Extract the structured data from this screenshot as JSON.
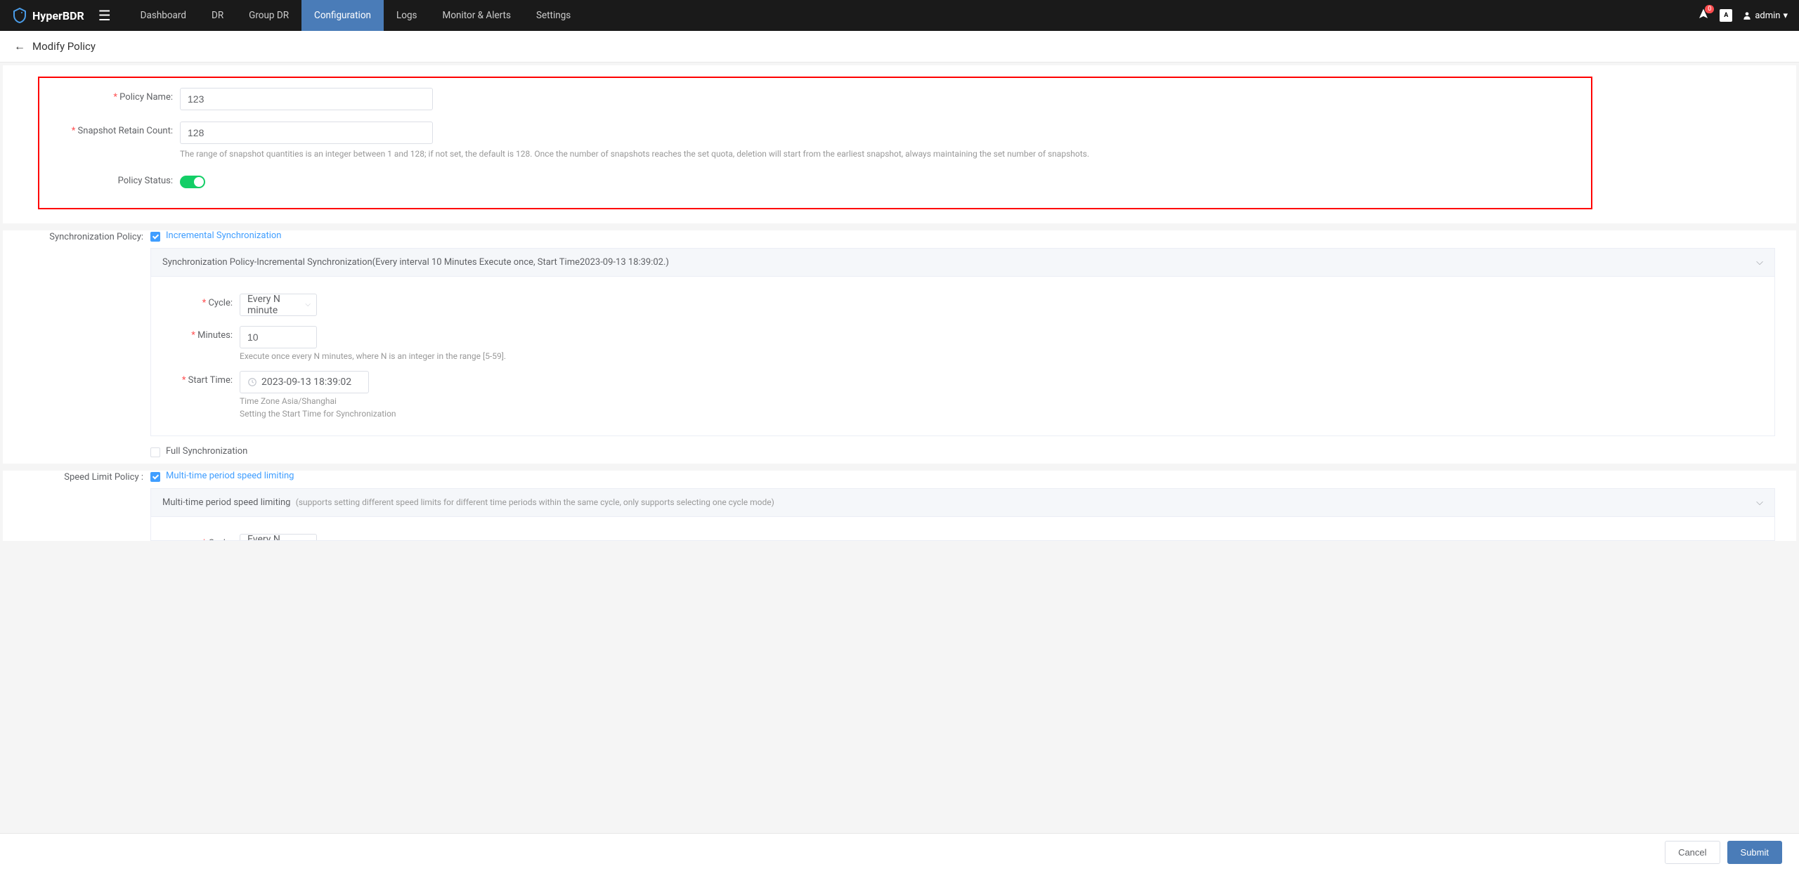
{
  "app": {
    "name": "HyperBDR"
  },
  "nav": {
    "items": [
      {
        "label": "Dashboard"
      },
      {
        "label": "DR"
      },
      {
        "label": "Group DR"
      },
      {
        "label": "Configuration"
      },
      {
        "label": "Logs"
      },
      {
        "label": "Monitor & Alerts"
      },
      {
        "label": "Settings"
      }
    ]
  },
  "header": {
    "badge": "0",
    "lang": "A",
    "user": "admin"
  },
  "breadcrumb": {
    "title": "Modify Policy"
  },
  "policy": {
    "name_label": "Policy Name:",
    "name_value": "123",
    "retain_label": "Snapshot Retain Count:",
    "retain_value": "128",
    "retain_help": "The range of snapshot quantities is an integer between 1 and 128; if not set, the default is 128. Once the number of snapshots reaches the set quota, deletion will start from the earliest snapshot, always maintaining the set number of snapshots.",
    "status_label": "Policy Status:"
  },
  "sync": {
    "section_label": "Synchronization Policy:",
    "incremental_label": "Incremental Synchronization",
    "collapse_title": "Synchronization Policy-Incremental Synchronization(Every interval 10 Minutes Execute once, Start Time2023-09-13 18:39:02.)",
    "cycle_label": "Cycle:",
    "cycle_value": "Every N minute",
    "minutes_label": "Minutes:",
    "minutes_value": "10",
    "minutes_help": "Execute once every N minutes, where N is an integer in the range [5-59].",
    "start_label": "Start Time:",
    "start_value": "2023-09-13 18:39:02",
    "tz_help": "Time Zone Asia/Shanghai",
    "start_help": "Setting the Start Time for Synchronization",
    "full_label": "Full Synchronization"
  },
  "speed": {
    "section_label": "Speed Limit Policy :",
    "multi_label": "Multi-time period speed limiting",
    "collapse_title": "Multi-time period speed limiting",
    "collapse_hint": "(supports setting different speed limits for different time periods within the same cycle, only supports selecting one cycle mode)",
    "cycle_label": "Cycle:",
    "cycle_value": "Every N days"
  },
  "footer": {
    "cancel": "Cancel",
    "submit": "Submit"
  }
}
